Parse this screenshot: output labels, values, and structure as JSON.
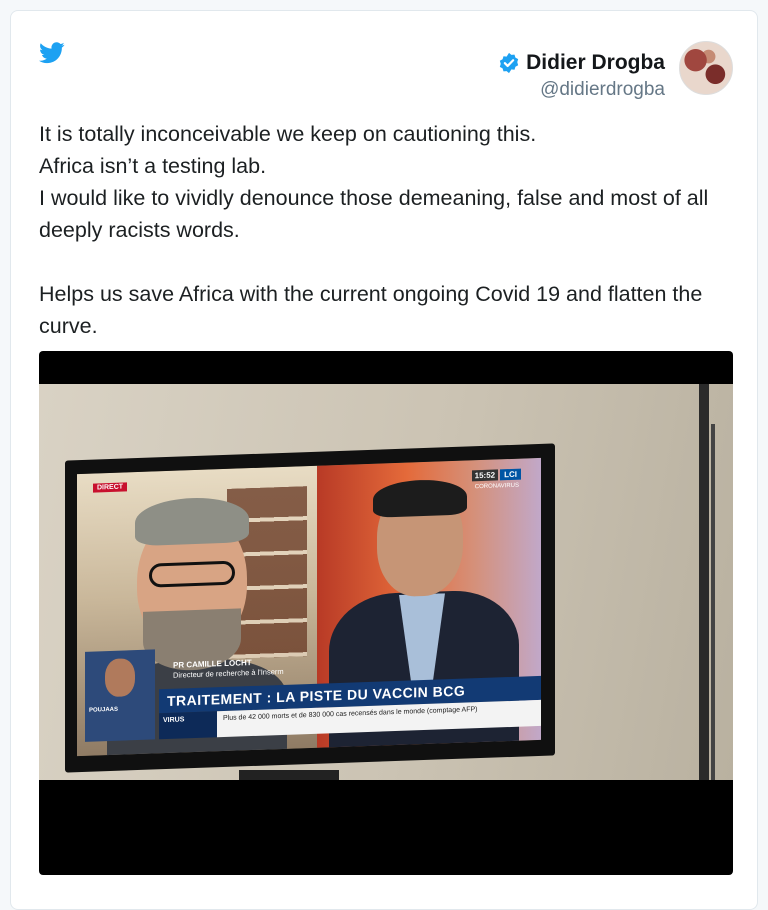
{
  "tweet": {
    "author_name": "Didier Drogba",
    "author_handle": "@didierdrogba",
    "text_lines_para1": [
      "It is totally inconceivable we keep on cautioning this.",
      "Africa isn’t a testing lab.",
      "I would like to vividly denounce those demeaning, false and most of all deeply racists words."
    ],
    "text_para2": "Helps us save Africa with the current ongoing Covid 19 and flatten the curve."
  },
  "video": {
    "direct_label": "DIRECT",
    "time": "15:52",
    "channel_logo": "LCI",
    "covid_tag": "CORONAVIRUS",
    "guest_name": "PR CAMILLE LOCHT",
    "guest_role": "Directeur de recherche à l'Inserm",
    "headline": "TRAITEMENT : LA PISTE DU VACCIN BCG",
    "category": "VIRUS",
    "subline": "Plus de 42 000 morts et de 830 000 cas recensés dans le monde (comptage AFP)",
    "inset_label": "POUJAAS"
  },
  "icons": {
    "logo": "twitter-bird-icon",
    "verified": "verified-badge-icon"
  },
  "colors": {
    "twitter_blue": "#1da1f2",
    "text": "#1c2022",
    "handle_gray": "#657786"
  }
}
